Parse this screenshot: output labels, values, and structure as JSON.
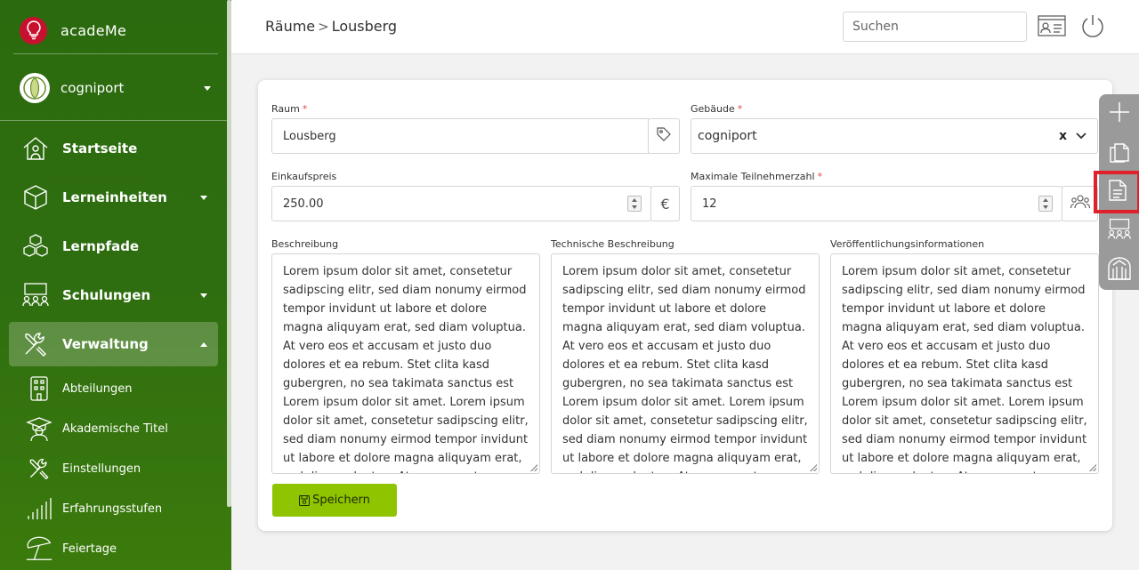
{
  "app": {
    "name": "acadeMe",
    "brand_color": "#c8102e"
  },
  "org": {
    "name": "cogniport"
  },
  "sidebar": {
    "items": [
      {
        "label": "Startseite",
        "icon": "house-icon"
      },
      {
        "label": "Lerneinheiten",
        "icon": "cube-icon"
      },
      {
        "label": "Lernpfade",
        "icon": "cubes-icon"
      },
      {
        "label": "Schulungen",
        "icon": "classroom-icon"
      },
      {
        "label": "Verwaltung",
        "icon": "tools-icon"
      }
    ],
    "subitems": [
      {
        "label": "Abteilungen",
        "icon": "building-icon"
      },
      {
        "label": "Akademische Titel",
        "icon": "graduation-icon"
      },
      {
        "label": "Einstellungen",
        "icon": "tools-icon"
      },
      {
        "label": "Erfahrungsstufen",
        "icon": "bars-icon"
      },
      {
        "label": "Feiertage",
        "icon": "beach-umbrella-icon"
      }
    ]
  },
  "header": {
    "breadcrumb": {
      "parent": "Räume",
      "separator": ">",
      "current": "Lousberg"
    },
    "search_placeholder": "Suchen"
  },
  "form": {
    "raum": {
      "label": "Raum",
      "value": "Lousberg",
      "required": "*"
    },
    "gebaeude": {
      "label": "Gebäude",
      "value": "cogniport",
      "clear": "x",
      "required": "*"
    },
    "einkaufspreis": {
      "label": "Einkaufspreis",
      "value": "250.00",
      "unit": "€"
    },
    "teilnehmer": {
      "label": "Maximale Teilnehmerzahl",
      "value": "12",
      "required": "*"
    },
    "beschreibung": {
      "label": "Beschreibung",
      "value": "Lorem ipsum dolor sit amet, consetetur sadipscing elitr, sed diam nonumy eirmod tempor invidunt ut labore et dolore magna aliquyam erat, sed diam voluptua. At vero eos et accusam et justo duo dolores et ea rebum. Stet clita kasd gubergren, no sea takimata sanctus est Lorem ipsum dolor sit amet. Lorem ipsum dolor sit amet, consetetur sadipscing elitr, sed diam nonumy eirmod tempor invidunt ut labore et dolore magna aliquyam erat, sed diam voluptua. At vero eos et accusam et justo duo dolores et ea rebum."
    },
    "technisch": {
      "label": "Technische Beschreibung",
      "value": "Lorem ipsum dolor sit amet, consetetur sadipscing elitr, sed diam nonumy eirmod tempor invidunt ut labore et dolore magna aliquyam erat, sed diam voluptua. At vero eos et accusam et justo duo dolores et ea rebum. Stet clita kasd gubergren, no sea takimata sanctus est Lorem ipsum dolor sit amet. Lorem ipsum dolor sit amet, consetetur sadipscing elitr, sed diam nonumy eirmod tempor invidunt ut labore et dolore magna aliquyam erat, sed diam voluptua. At vero eos et accusam et justo duo dolores et ea rebum."
    },
    "veroeffentlichung": {
      "label": "Veröffentlichungsinformationen",
      "value": "Lorem ipsum dolor sit amet, consetetur sadipscing elitr, sed diam nonumy eirmod tempor invidunt ut labore et dolore magna aliquyam erat, sed diam voluptua. At vero eos et accusam et justo duo dolores et ea rebum. Stet clita kasd gubergren, no sea takimata sanctus est Lorem ipsum dolor sit amet. Lorem ipsum dolor sit amet, consetetur sadipscing elitr, sed diam nonumy eirmod tempor invidunt ut labore et dolore magna aliquyam erat, sed diam voluptua. At vero eos et accusam et justo duo dolores et ea rebum."
    },
    "save_label": "Speichern"
  },
  "rail": {
    "buttons": [
      "plus-icon",
      "copy-icon",
      "document-icon",
      "classroom-icon",
      "building-arch-icon"
    ],
    "highlight_color": "#e0202a"
  }
}
